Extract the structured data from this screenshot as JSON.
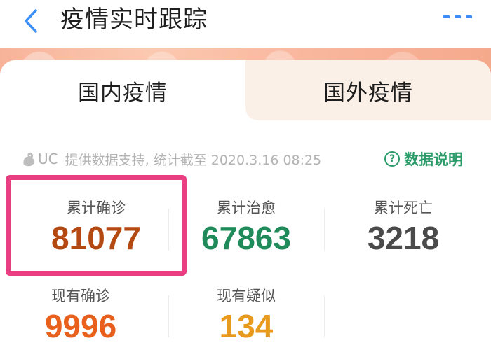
{
  "header": {
    "title": "疫情实时跟踪",
    "back_icon": "chevron-left-icon",
    "more_icon": "more-dots-icon",
    "accent_color": "#3a8ef5"
  },
  "tabs": [
    {
      "label": "国内疫情",
      "active": true
    },
    {
      "label": "国外疫情",
      "active": false
    }
  ],
  "source": {
    "logo_text": "UC",
    "text": "提供数据支持, 统计截至 2020.3.16 08:25"
  },
  "data_help": {
    "label": "数据说明",
    "icon_glyph": "?",
    "color": "#2b9b6a"
  },
  "stats": [
    {
      "label": "累计确诊",
      "value": "81077",
      "color": "#b44a12"
    },
    {
      "label": "累计治愈",
      "value": "67863",
      "color": "#1f8a5a"
    },
    {
      "label": "累计死亡",
      "value": "3218",
      "color": "#4a4a4a"
    },
    {
      "label": "现有确诊",
      "value": "9996",
      "color": "#e8601c"
    },
    {
      "label": "现有疑似",
      "value": "134",
      "color": "#e89a1c"
    }
  ],
  "highlight_color": "#e93f82"
}
